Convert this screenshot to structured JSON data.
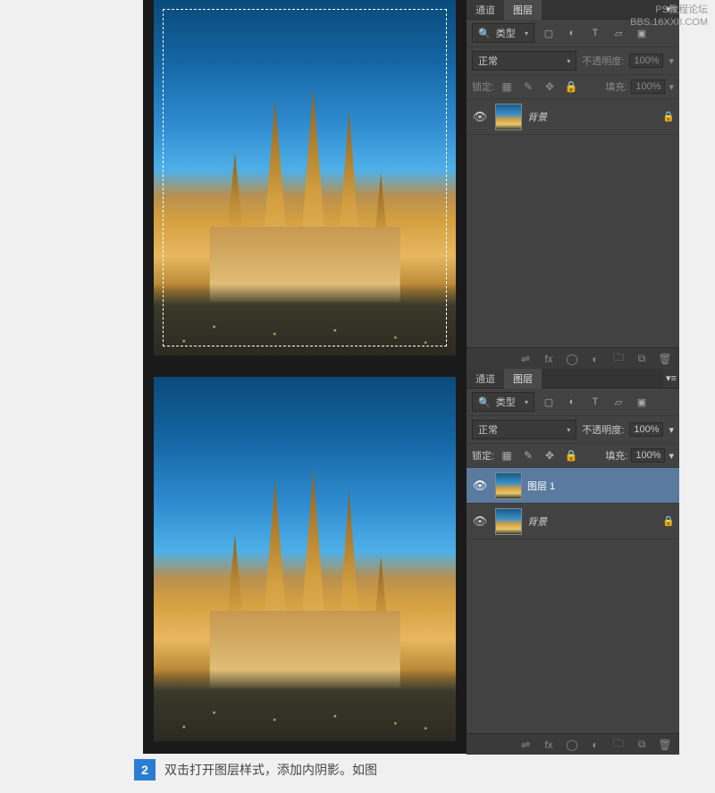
{
  "watermark": {
    "line1": "PS教程论坛",
    "line2": "BBS.16XX8.COM"
  },
  "panels": {
    "tabs": {
      "channels": "通道",
      "layers": "图层"
    },
    "filter_label": "类型",
    "icons": {
      "search": "🔍",
      "image": "▢",
      "adjust": "◐",
      "type": "T",
      "shape": "▱",
      "smart": "▣",
      "menu": "▾≡"
    },
    "blend_mode": "正常",
    "opacity_label": "不透明度:",
    "opacity_value_top": "100%",
    "opacity_value_bottom": "100%",
    "lock_label": "锁定:",
    "fill_label": "填充:",
    "fill_value_top": "100%",
    "fill_value_bottom": "100%",
    "lock_icons": {
      "pixels": "▦",
      "brush": "✎",
      "pos": "✥",
      "all": "🔒"
    }
  },
  "layers_top": [
    {
      "name": "背景",
      "locked": true
    }
  ],
  "layers_bottom": [
    {
      "name": "图层 1",
      "locked": false,
      "selected": true
    },
    {
      "name": "背景",
      "locked": true
    }
  ],
  "footer_icons": {
    "link": "⇌",
    "fx": "fx",
    "mask": "◯",
    "adjlayer": "◐",
    "group": "🗀",
    "new": "⧉",
    "trash": "🗑"
  },
  "step": {
    "num": "2",
    "text": "双击打开图层样式，添加内阴影。如图"
  }
}
